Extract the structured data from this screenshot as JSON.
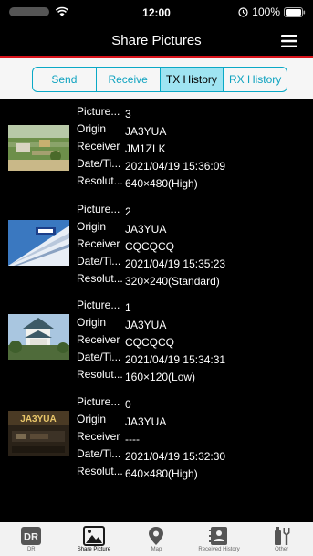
{
  "status": {
    "time": "12:00",
    "battery": "100%"
  },
  "nav": {
    "title": "Share Pictures"
  },
  "tabs": [
    {
      "label": "Send",
      "active": false
    },
    {
      "label": "Receive",
      "active": false
    },
    {
      "label": "TX History",
      "active": true
    },
    {
      "label": "RX History",
      "active": false
    }
  ],
  "entries": [
    {
      "picture_label": "Picture...",
      "picture": "3",
      "origin_label": "Origin",
      "origin": "JA3YUA",
      "receiver_label": "Receiver",
      "receiver": "JM1ZLK",
      "date_label": "Date/Ti...",
      "date": "2021/04/19 15:36:09",
      "res_label": "Resolut...",
      "resolution": "640×480(High)"
    },
    {
      "picture_label": "Picture...",
      "picture": "2",
      "origin_label": "Origin",
      "origin": "JA3YUA",
      "receiver_label": "Receiver",
      "receiver": "CQCQCQ",
      "date_label": "Date/Ti...",
      "date": "2021/04/19 15:35:23",
      "res_label": "Resolut...",
      "resolution": "320×240(Standard)"
    },
    {
      "picture_label": "Picture...",
      "picture": "1",
      "origin_label": "Origin",
      "origin": "JA3YUA",
      "receiver_label": "Receiver",
      "receiver": "CQCQCQ",
      "date_label": "Date/Ti...",
      "date": "2021/04/19 15:34:31",
      "res_label": "Resolut...",
      "resolution": "160×120(Low)"
    },
    {
      "picture_label": "Picture...",
      "picture": "0",
      "origin_label": "Origin",
      "origin": "JA3YUA",
      "receiver_label": "Receiver",
      "receiver": "----",
      "date_label": "Date/Ti...",
      "date": "2021/04/19 15:32:30",
      "res_label": "Resolut...",
      "resolution": "640×480(High)"
    }
  ],
  "thumb3_text": "JA3YUA",
  "tabbar": [
    {
      "label": "DR",
      "icon": "dr-icon",
      "active": false
    },
    {
      "label": "Share Picture",
      "icon": "picture-icon",
      "active": true
    },
    {
      "label": "Map",
      "icon": "map-pin-icon",
      "active": false
    },
    {
      "label": "Received History",
      "icon": "contacts-icon",
      "active": false
    },
    {
      "label": "Other",
      "icon": "tools-icon",
      "active": false
    }
  ],
  "colors": {
    "accent": "#0aa9c6",
    "active_tab_bg": "#9fe4f2",
    "red_line": "#d9141c"
  }
}
